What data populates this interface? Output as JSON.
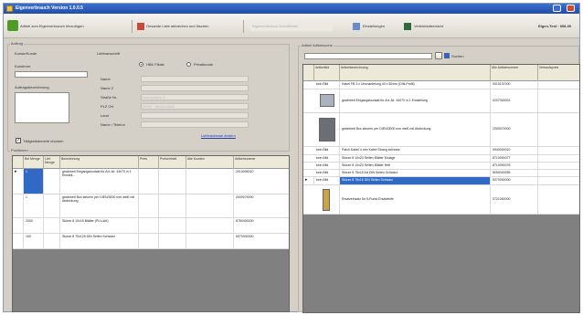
{
  "window": {
    "title": "Eigenverbrauch Version 1.0.0.5"
  },
  "toolbar": {
    "new_label": "Artikel zum Eigenverbrauch hinzufügen",
    "delete_label": "Gesamte Liste abbrechen und löschen",
    "disabled_label": "Eigenverbrauch durchführen",
    "settings_label": "Einstellungen",
    "sales_label": "Vertriebsübersicht",
    "user_label": "Eigen-Test · 008-00"
  },
  "left": {
    "order_group": "Auftrag",
    "customer_group": "Kunde/Kunde",
    "customer_no_label": "Kundennr.",
    "order_desc_label": "Auftragsbezeichnung",
    "project_group": "Lieferanschrift",
    "radio_options": [
      "HBK Filiale",
      "Privatkunde"
    ],
    "address_labels": [
      "Name",
      "Name 2",
      "Straße Nr.",
      "PLZ Ort",
      "Land",
      "Name / Telefon"
    ],
    "address_values": [
      "",
      "",
      "Hauptstraße 3",
      "10000 · Musterstadt",
      "",
      ""
    ],
    "address_link": "Lieferadresse ändern",
    "checkbox_label": "Tätigkeitsbericht drucken",
    "grid_group": "Positionen",
    "grid_headers": [
      "Bei Menge",
      "Lief. Menge",
      "Bezeichnung",
      "Preis",
      "Preiseinheit",
      "Alle Kunden",
      "Artikelnummer"
    ],
    "grid_rows": [
      {
        "qty": "1",
        "text": "gewinkelt Eingangskontakt für Art.-Nr. 44070 in 1 Einstell...",
        "art": "2010005010"
      },
      {
        "qty": "1",
        "text": "gewinkelt Box steuern per DIEN/3000 mm weiß mit Abdeckung",
        "art": "2000079000"
      },
      {
        "qty": "2000",
        "text": "Skizze 8 10x15 Blätter (PLU-Art)",
        "art": "8750400000"
      },
      {
        "qty": "100",
        "text": "Skizze 8 75x125 DIN Seiten Schwarz",
        "art": "5070000000"
      }
    ]
  },
  "right": {
    "group": "Artikel Artikelsuche",
    "search_value": "",
    "search_button": "Suchen",
    "grid_headers": [
      "Artikelbild",
      "Artikelbezeichnung",
      "Alle Artikelnummer",
      "Verkaufspreis"
    ],
    "grid_rows": [
      {
        "badge": "kein Bild",
        "text": "Kabel FB 3 x Ummantelung 40 x 50mm (DIN-Profil)",
        "art": "0010137000"
      },
      {
        "badge": "",
        "text": "gewinkelt Eingangskontakt für Art.-Nr. 44070 in 1 Einstellung",
        "art": "0207000001"
      },
      {
        "badge": "",
        "text": "gewinkelt Box steuern per DIEN/3000 mm weiß mit Abdeckung",
        "art": "2000070000"
      },
      {
        "badge": "kein Bild",
        "text": "Patch Kabel 4 mm Kabel Strang schwarz",
        "art": "0940000010"
      },
      {
        "badge": "kein Bild",
        "text": "Skizze 8 10x20 Seiten Blätter Einlage",
        "art": "8710000077"
      },
      {
        "badge": "kein Bild",
        "text": "Skizze 8 10x20 Seiten Blätter Heft",
        "art": "8710000076"
      },
      {
        "badge": "kein Bild",
        "text": "Skizze 8 75x15 Art DIN Seiten Schwarz",
        "art": "8050000055"
      },
      {
        "badge": "kein Bild",
        "text": "Skizze 8 75x15 DIN Seiten Schwarz",
        "art": "5070000000"
      },
      {
        "badge": "",
        "text": "Ersatzeinsatz für 5-Punkt-Ersatzteile",
        "art": "0721000000"
      }
    ]
  }
}
